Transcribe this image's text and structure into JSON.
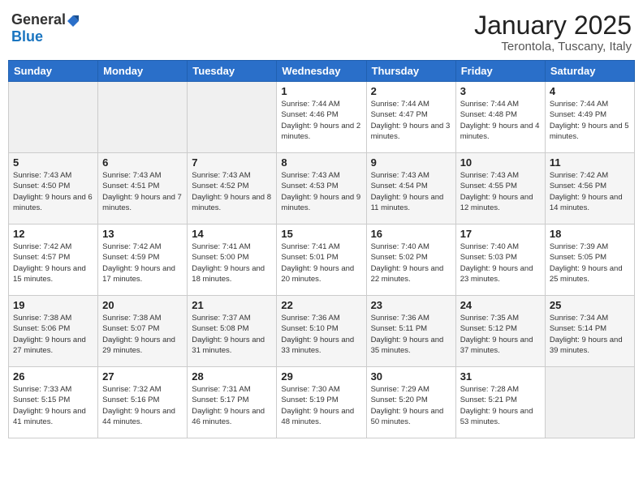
{
  "logo": {
    "general": "General",
    "blue": "Blue"
  },
  "title": "January 2025",
  "subtitle": "Terontola, Tuscany, Italy",
  "weekdays": [
    "Sunday",
    "Monday",
    "Tuesday",
    "Wednesday",
    "Thursday",
    "Friday",
    "Saturday"
  ],
  "weeks": [
    [
      {
        "day": "",
        "info": ""
      },
      {
        "day": "",
        "info": ""
      },
      {
        "day": "",
        "info": ""
      },
      {
        "day": "1",
        "info": "Sunrise: 7:44 AM\nSunset: 4:46 PM\nDaylight: 9 hours and 2 minutes."
      },
      {
        "day": "2",
        "info": "Sunrise: 7:44 AM\nSunset: 4:47 PM\nDaylight: 9 hours and 3 minutes."
      },
      {
        "day": "3",
        "info": "Sunrise: 7:44 AM\nSunset: 4:48 PM\nDaylight: 9 hours and 4 minutes."
      },
      {
        "day": "4",
        "info": "Sunrise: 7:44 AM\nSunset: 4:49 PM\nDaylight: 9 hours and 5 minutes."
      }
    ],
    [
      {
        "day": "5",
        "info": "Sunrise: 7:43 AM\nSunset: 4:50 PM\nDaylight: 9 hours and 6 minutes."
      },
      {
        "day": "6",
        "info": "Sunrise: 7:43 AM\nSunset: 4:51 PM\nDaylight: 9 hours and 7 minutes."
      },
      {
        "day": "7",
        "info": "Sunrise: 7:43 AM\nSunset: 4:52 PM\nDaylight: 9 hours and 8 minutes."
      },
      {
        "day": "8",
        "info": "Sunrise: 7:43 AM\nSunset: 4:53 PM\nDaylight: 9 hours and 9 minutes."
      },
      {
        "day": "9",
        "info": "Sunrise: 7:43 AM\nSunset: 4:54 PM\nDaylight: 9 hours and 11 minutes."
      },
      {
        "day": "10",
        "info": "Sunrise: 7:43 AM\nSunset: 4:55 PM\nDaylight: 9 hours and 12 minutes."
      },
      {
        "day": "11",
        "info": "Sunrise: 7:42 AM\nSunset: 4:56 PM\nDaylight: 9 hours and 14 minutes."
      }
    ],
    [
      {
        "day": "12",
        "info": "Sunrise: 7:42 AM\nSunset: 4:57 PM\nDaylight: 9 hours and 15 minutes."
      },
      {
        "day": "13",
        "info": "Sunrise: 7:42 AM\nSunset: 4:59 PM\nDaylight: 9 hours and 17 minutes."
      },
      {
        "day": "14",
        "info": "Sunrise: 7:41 AM\nSunset: 5:00 PM\nDaylight: 9 hours and 18 minutes."
      },
      {
        "day": "15",
        "info": "Sunrise: 7:41 AM\nSunset: 5:01 PM\nDaylight: 9 hours and 20 minutes."
      },
      {
        "day": "16",
        "info": "Sunrise: 7:40 AM\nSunset: 5:02 PM\nDaylight: 9 hours and 22 minutes."
      },
      {
        "day": "17",
        "info": "Sunrise: 7:40 AM\nSunset: 5:03 PM\nDaylight: 9 hours and 23 minutes."
      },
      {
        "day": "18",
        "info": "Sunrise: 7:39 AM\nSunset: 5:05 PM\nDaylight: 9 hours and 25 minutes."
      }
    ],
    [
      {
        "day": "19",
        "info": "Sunrise: 7:38 AM\nSunset: 5:06 PM\nDaylight: 9 hours and 27 minutes."
      },
      {
        "day": "20",
        "info": "Sunrise: 7:38 AM\nSunset: 5:07 PM\nDaylight: 9 hours and 29 minutes."
      },
      {
        "day": "21",
        "info": "Sunrise: 7:37 AM\nSunset: 5:08 PM\nDaylight: 9 hours and 31 minutes."
      },
      {
        "day": "22",
        "info": "Sunrise: 7:36 AM\nSunset: 5:10 PM\nDaylight: 9 hours and 33 minutes."
      },
      {
        "day": "23",
        "info": "Sunrise: 7:36 AM\nSunset: 5:11 PM\nDaylight: 9 hours and 35 minutes."
      },
      {
        "day": "24",
        "info": "Sunrise: 7:35 AM\nSunset: 5:12 PM\nDaylight: 9 hours and 37 minutes."
      },
      {
        "day": "25",
        "info": "Sunrise: 7:34 AM\nSunset: 5:14 PM\nDaylight: 9 hours and 39 minutes."
      }
    ],
    [
      {
        "day": "26",
        "info": "Sunrise: 7:33 AM\nSunset: 5:15 PM\nDaylight: 9 hours and 41 minutes."
      },
      {
        "day": "27",
        "info": "Sunrise: 7:32 AM\nSunset: 5:16 PM\nDaylight: 9 hours and 44 minutes."
      },
      {
        "day": "28",
        "info": "Sunrise: 7:31 AM\nSunset: 5:17 PM\nDaylight: 9 hours and 46 minutes."
      },
      {
        "day": "29",
        "info": "Sunrise: 7:30 AM\nSunset: 5:19 PM\nDaylight: 9 hours and 48 minutes."
      },
      {
        "day": "30",
        "info": "Sunrise: 7:29 AM\nSunset: 5:20 PM\nDaylight: 9 hours and 50 minutes."
      },
      {
        "day": "31",
        "info": "Sunrise: 7:28 AM\nSunset: 5:21 PM\nDaylight: 9 hours and 53 minutes."
      },
      {
        "day": "",
        "info": ""
      }
    ]
  ]
}
